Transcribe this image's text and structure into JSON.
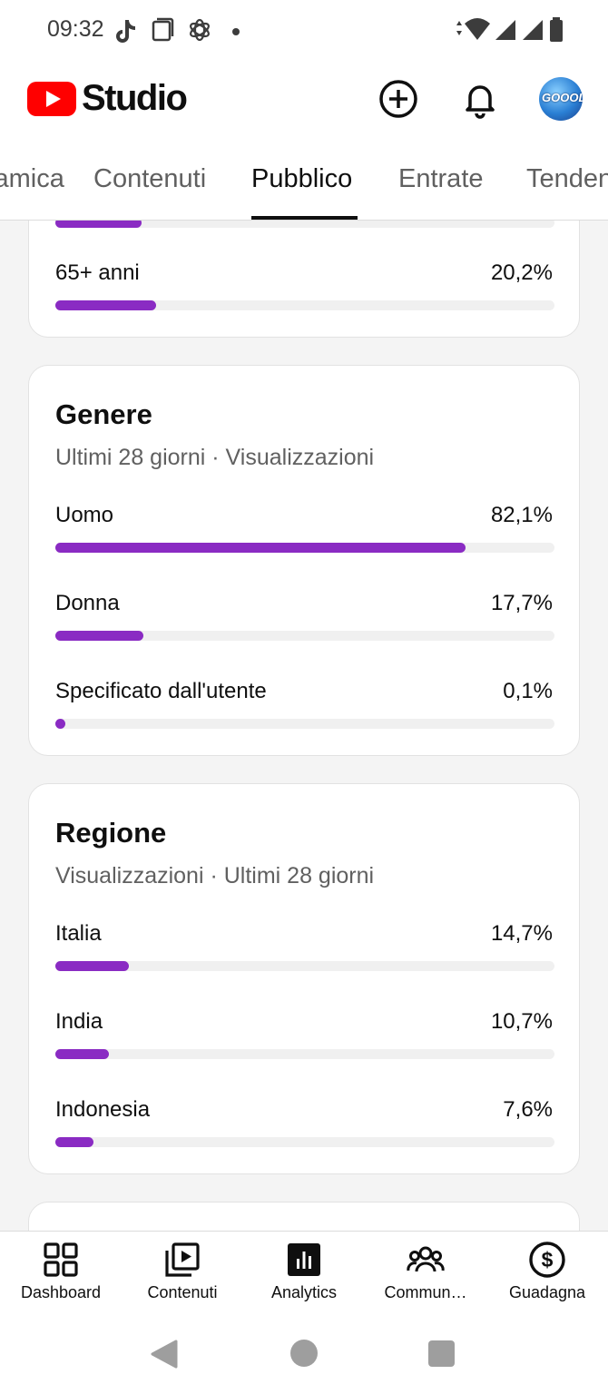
{
  "status_bar": {
    "time": "09:32"
  },
  "app": {
    "title": "Studio"
  },
  "tabs": [
    {
      "label": "Dinamica"
    },
    {
      "label": "Contenuti"
    },
    {
      "label": "Pubblico"
    },
    {
      "label": "Entrate"
    },
    {
      "label": "Tendenze"
    }
  ],
  "active_tab": "Pubblico",
  "age_card": {
    "rows": [
      {
        "label": "65+ anni",
        "value": "20,2%",
        "fraction": 0.202
      }
    ]
  },
  "gender_card": {
    "title": "Genere",
    "subtitle": "Ultimi 28 giorni · Visualizzazioni",
    "rows": [
      {
        "label": "Uomo",
        "value": "82,1%",
        "fraction": 0.821
      },
      {
        "label": "Donna",
        "value": "17,7%",
        "fraction": 0.177
      },
      {
        "label": "Specificato dall'utente",
        "value": "0,1%",
        "fraction": 0.001
      }
    ]
  },
  "region_card": {
    "title": "Regione",
    "subtitle": "Visualizzazioni · Ultimi 28 giorni",
    "rows": [
      {
        "label": "Italia",
        "value": "14,7%",
        "fraction": 0.147
      },
      {
        "label": "India",
        "value": "10,7%",
        "fraction": 0.107
      },
      {
        "label": "Indonesia",
        "value": "7,6%",
        "fraction": 0.076
      }
    ]
  },
  "bottom_nav": [
    {
      "label": "Dashboard",
      "icon": "dashboard-icon"
    },
    {
      "label": "Contenuti",
      "icon": "content-icon"
    },
    {
      "label": "Analytics",
      "icon": "analytics-icon"
    },
    {
      "label": "Commun…",
      "icon": "community-icon"
    },
    {
      "label": "Guadagna",
      "icon": "earn-icon"
    }
  ],
  "colors": {
    "accent": "#8a2bc3",
    "youtube_red": "#ff0000"
  }
}
